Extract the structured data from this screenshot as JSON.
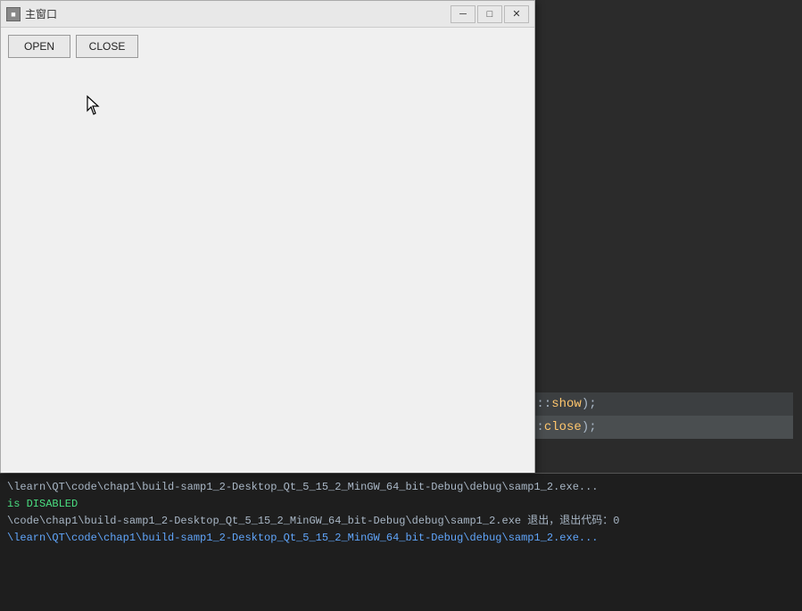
{
  "window": {
    "title": "主窗口",
    "icon_label": "■"
  },
  "titlebar": {
    "minimize_label": "─",
    "maximize_label": "□",
    "close_label": "✕"
  },
  "toolbar": {
    "open_label": "OPEN",
    "close_label": "CLOSE"
  },
  "editor": {
    "lines": [
      {
        "text": "t::show);"
      },
      {
        "text": "::close);"
      }
    ]
  },
  "output": {
    "line1": "\\learn\\QT\\code\\chap1\\build-samp1_2-Desktop_Qt_5_15_2_MinGW_64_bit-Debug\\debug\\samp1_2.exe...",
    "line2": "is DISABLED",
    "line3": "\\code\\chap1\\build-samp1_2-Desktop_Qt_5_15_2_MinGW_64_bit-Debug\\debug\\samp1_2.exe 退出，退出代码：0",
    "line4": "\\learn\\QT\\code\\chap1\\build-samp1_2-Desktop_Qt_5_15_2_MinGW_64_bit-Debug\\debug\\samp1_2.exe..."
  }
}
